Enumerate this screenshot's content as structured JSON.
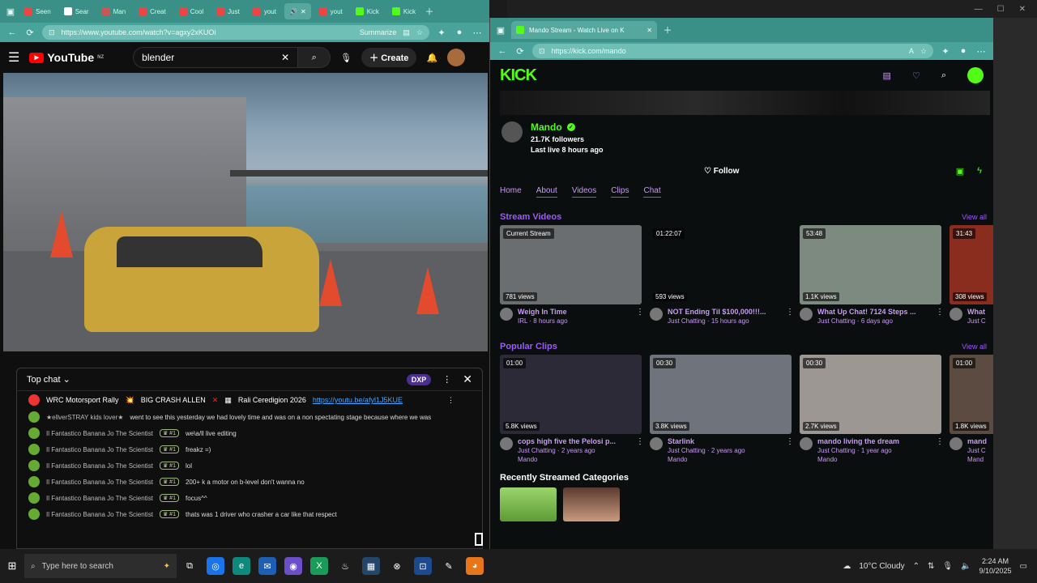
{
  "left_window": {
    "tabs": [
      "Seen",
      "Sear",
      "Man",
      "Creat",
      "Cool",
      "Just",
      "yout",
      "yout",
      "Kick",
      "Kick"
    ],
    "url": "https://www.youtube.com/watch?v=agxy2xKUOi",
    "url_extra": "Summarize",
    "youtube": {
      "logo_text": "YouTube",
      "region": "NZ",
      "search_value": "blender",
      "create_label": "Create"
    },
    "chat": {
      "title": "Top chat",
      "dxp": "DXP",
      "pinned": {
        "user": "WRC Motorsport Rally",
        "text": "BIG CRASH ALLEN",
        "text2": "Rali Ceredigion 2026",
        "link": "https://youtu.be/afyl1J5KUE"
      },
      "messages": [
        {
          "user": "★ellverSTRAY kids lover★",
          "badge": "",
          "text": "went to see this yesterday we had lovely time and was on a non spectating stage because where we was"
        },
        {
          "user": "Il Fantastico Banana Jo The Scientist",
          "badge": "#1",
          "text": "we\\a/ll live editing"
        },
        {
          "user": "Il Fantastico Banana Jo The Scientist",
          "badge": "#1",
          "text": "freakz =)"
        },
        {
          "user": "Il Fantastico Banana Jo The Scientist",
          "badge": "#1",
          "text": "lol"
        },
        {
          "user": "Il Fantastico Banana Jo The Scientist",
          "badge": "#1",
          "text": "200+ k a motor on b-level don't wanna no"
        },
        {
          "user": "Il Fantastico Banana Jo The Scientist",
          "badge": "#1",
          "text": "focus^^"
        },
        {
          "user": "Il Fantastico Banana Jo The Scientist",
          "badge": "#1",
          "text": "thats was 1 driver who crasher a car like that respect"
        }
      ]
    }
  },
  "right_window": {
    "tab_title": "Mando Stream - Watch Live on K",
    "url": "https://kick.com/mando",
    "logo": "KICK",
    "channel": {
      "name": "Mando",
      "followers": "21.7K followers",
      "last_live": "Last live 8 hours ago",
      "follow_label": "Follow"
    },
    "tabs": [
      "Home",
      "About",
      "Videos",
      "Clips",
      "Chat"
    ],
    "stream_videos": {
      "title": "Stream Videos",
      "view_all": "View all",
      "items": [
        {
          "tag": "Current Stream",
          "views": "781 views",
          "title": "Weigh In Time",
          "category": "IRL",
          "time": "8 hours ago",
          "color": "#6b6e70"
        },
        {
          "tag": "01:22:07",
          "views": "593 views",
          "title": "NOT Ending Til $100,000!!!...",
          "category": "Just Chatting",
          "time": "15 hours ago",
          "color": "#0b0e0f"
        },
        {
          "tag": "53:48",
          "views": "1.1K views",
          "title": "What Up Chat! 7124 Steps ...",
          "category": "Just Chatting",
          "time": "6 days ago",
          "color": "#7d8a7f"
        },
        {
          "tag": "31:43",
          "views": "308 views",
          "title": "What",
          "category": "Just C",
          "time": "",
          "color": "#8a2c1e"
        }
      ]
    },
    "popular_clips": {
      "title": "Popular Clips",
      "view_all": "View all",
      "items": [
        {
          "tag": "01:00",
          "views": "5.8K views",
          "title": "cops high five the Pelosi p...",
          "category": "Just Chatting",
          "time": "2 years ago",
          "channel": "Mando",
          "color": "#2c2a36"
        },
        {
          "tag": "00:30",
          "views": "3.8K views",
          "title": "Starlink",
          "category": "Just Chatting",
          "time": "2 years ago",
          "channel": "Mando",
          "color": "#6f747c"
        },
        {
          "tag": "00:30",
          "views": "2.7K views",
          "title": "mando living the dream",
          "category": "Just Chatting",
          "time": "1 year ago",
          "channel": "Mando",
          "color": "#9d9794"
        },
        {
          "tag": "01:00",
          "views": "1.8K views",
          "title": "mand",
          "category": "Just C",
          "time": "",
          "channel": "Mand",
          "color": "#5b4b40"
        }
      ]
    },
    "recent_title": "Recently Streamed Categories"
  },
  "taskbar": {
    "search_placeholder": "Type here to search",
    "weather": "10°C  Cloudy",
    "time": "2:24 AM",
    "date": "9/10/2025"
  }
}
